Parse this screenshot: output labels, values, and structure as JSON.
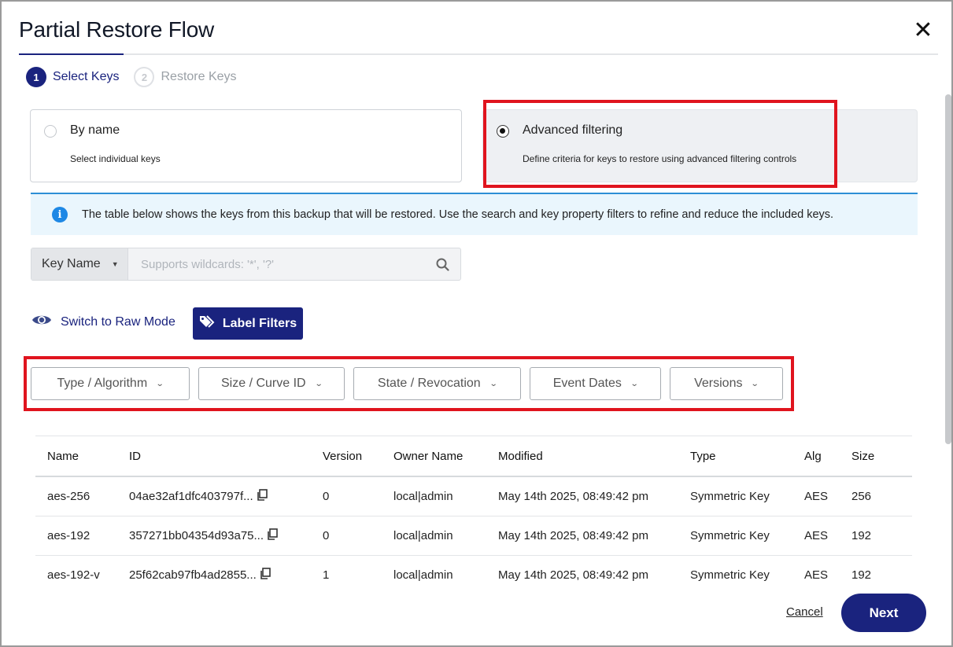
{
  "dialog": {
    "title": "Partial Restore Flow",
    "close_icon": "close-icon"
  },
  "steps": [
    {
      "num": "1",
      "label": "Select Keys",
      "state": "active"
    },
    {
      "num": "2",
      "label": "Restore Keys",
      "state": "inactive"
    }
  ],
  "modes": {
    "by_name": {
      "title": "By name",
      "desc": "Select individual keys",
      "selected": false
    },
    "advanced": {
      "title": "Advanced filtering",
      "desc": "Define criteria for keys to restore using advanced filtering controls",
      "selected": true
    }
  },
  "info": {
    "icon": "info-icon",
    "text": "The table below shows the keys from this backup that will be restored. Use the search and key property filters to refine and reduce the included keys."
  },
  "search": {
    "field_select": "Key Name",
    "placeholder": "Supports wildcards: '*', '?'",
    "value": "",
    "icon": "search-icon"
  },
  "toolbar": {
    "raw_mode_label": "Switch to Raw Mode",
    "raw_mode_icon": "eye-icon",
    "label_filters": "Label Filters",
    "label_filters_icon": "tags-icon"
  },
  "filters": [
    {
      "label": "Type / Algorithm"
    },
    {
      "label": "Size / Curve ID"
    },
    {
      "label": "State / Revocation"
    },
    {
      "label": "Event Dates"
    },
    {
      "label": "Versions"
    }
  ],
  "table": {
    "columns": [
      "Name",
      "ID",
      "Version",
      "Owner Name",
      "Modified",
      "Type",
      "Alg",
      "Size"
    ],
    "rows": [
      {
        "name": "aes-256",
        "id": "04ae32af1dfc403797f...",
        "version": "0",
        "owner": "local|admin",
        "modified": "May 14th 2025, 08:49:42 pm",
        "type": "Symmetric Key",
        "alg": "AES",
        "size": "256"
      },
      {
        "name": "aes-192",
        "id": "357271bb04354d93a75...",
        "version": "0",
        "owner": "local|admin",
        "modified": "May 14th 2025, 08:49:42 pm",
        "type": "Symmetric Key",
        "alg": "AES",
        "size": "192"
      },
      {
        "name": "aes-192-v",
        "id": "25f62cab97fb4ad2855...",
        "version": "1",
        "owner": "local|admin",
        "modified": "May 14th 2025, 08:49:42 pm",
        "type": "Symmetric Key",
        "alg": "AES",
        "size": "192"
      }
    ]
  },
  "footer": {
    "cancel": "Cancel",
    "next": "Next"
  },
  "colors": {
    "primary": "#1a237e",
    "highlight": "#e0141e",
    "info_bg": "#eaf6fd",
    "info_accent": "#1e88e5"
  }
}
